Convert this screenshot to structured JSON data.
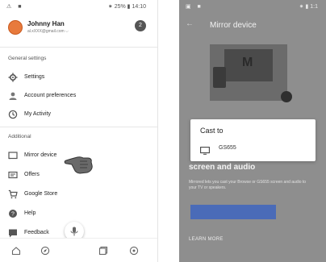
{
  "left": {
    "status": {
      "left": "⚠ ■",
      "right": "⁕ 25% ▮ 14:10"
    },
    "account": {
      "name": "Johnny Han",
      "email": "al.xXXX@gmail.com  ⌵",
      "badge": "2"
    },
    "sections": {
      "general": "General settings",
      "additional": "Additional"
    },
    "menu": [
      {
        "label": "Settings",
        "icon": "gear-icon"
      },
      {
        "label": "Account preferences",
        "icon": "account-icon"
      },
      {
        "label": "My Activity",
        "icon": "history-icon"
      },
      {
        "label": "Mirror device",
        "icon": "cast-icon"
      },
      {
        "label": "Offers",
        "icon": "offers-icon"
      },
      {
        "label": "Google Store",
        "icon": "cart-icon"
      },
      {
        "label": "Help",
        "icon": "help-icon"
      },
      {
        "label": "Feedback",
        "icon": "feedback-icon"
      }
    ]
  },
  "right": {
    "status": {
      "left": "▣ ■",
      "right": "⁕ ▮ 1:1"
    },
    "title": "Mirror device",
    "dialog": {
      "title": "Cast to",
      "device": "GS655"
    },
    "subhead": "screen and audio",
    "body": "Mirrored lets you cast your Browse or GS655 screen and audio to your TV or speakers.",
    "learn_more": "LEARN MORE"
  }
}
